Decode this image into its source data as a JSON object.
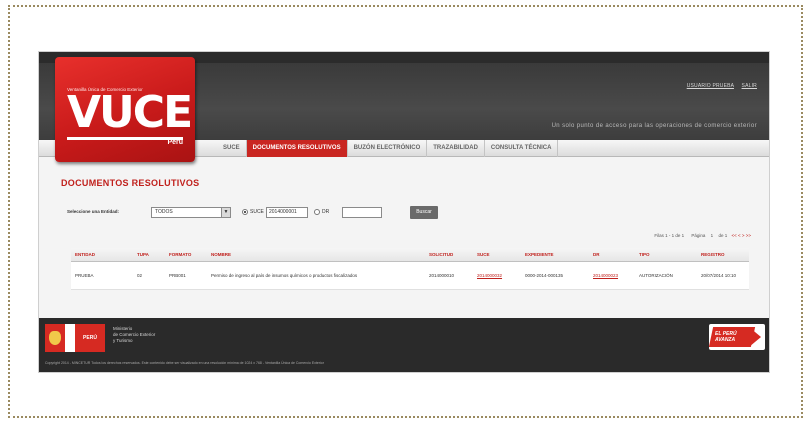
{
  "header": {
    "user_links": [
      "USUARIO PRUEBA",
      "SALIR"
    ],
    "tagline": "Un solo punto de acceso para las operaciones de comercio exterior"
  },
  "logo": {
    "subtitle": "Ventanilla Única de Comercio Exterior",
    "word": "VUCE",
    "country": "Perú"
  },
  "nav": {
    "tabs": [
      "SUCE",
      "DOCUMENTOS RESOLUTIVOS",
      "BUZÓN ELECTRÓNICO",
      "TRAZABILIDAD",
      "CONSULTA TÉCNICA"
    ],
    "active_index": 1
  },
  "page": {
    "title": "DOCUMENTOS RESOLUTIVOS"
  },
  "search": {
    "entity_label": "Seleccione una Entidad:",
    "entity_value": "TODOS",
    "option_suce": "SUCE",
    "suce_value": "2014000001",
    "option_dr": "DR",
    "button_label": "Buscar"
  },
  "pager": {
    "summary": "Filas 1 - 1 de 1",
    "page_label": "Página",
    "page_value": "1",
    "of_label": "de 1",
    "links": "<< < > >>"
  },
  "table": {
    "headers": [
      "ENTIDAD",
      "TUPA",
      "FORMATO",
      "NOMBRE",
      "SOLICITUD",
      "SUCE",
      "EXPEDIENTE",
      "DR",
      "TIPO",
      "REGISTRO"
    ],
    "rows": [
      [
        "PRUEBA",
        "02",
        "PRB001",
        "Permiso de ingreso al país de insumos químicos o productos fiscalizados",
        "2014000010",
        "2014000032",
        "0000-2014-000135",
        "2014000023",
        "AUTORIZACIÓN",
        "20/07/2014 10:10"
      ]
    ]
  },
  "footer": {
    "flag_text": "PERÚ",
    "ministry": [
      "Ministerio",
      "de Comercio Exterior",
      "y Turismo"
    ],
    "copyright": "Copyright 2014 - MINCETUR Todos los derechos reservados. Este contenido debe ser visualizado en una resolución mínima de 1024 x 768 - Ventanilla Única de Comercio Exterior",
    "brand": [
      "EL PERÚ",
      "AVANZA"
    ]
  },
  "colors": {
    "accent": "#c92621",
    "header_bg": "#3a3a3a",
    "footer_bg": "#2a2a2a",
    "frame_dots": "#9a8a60"
  }
}
